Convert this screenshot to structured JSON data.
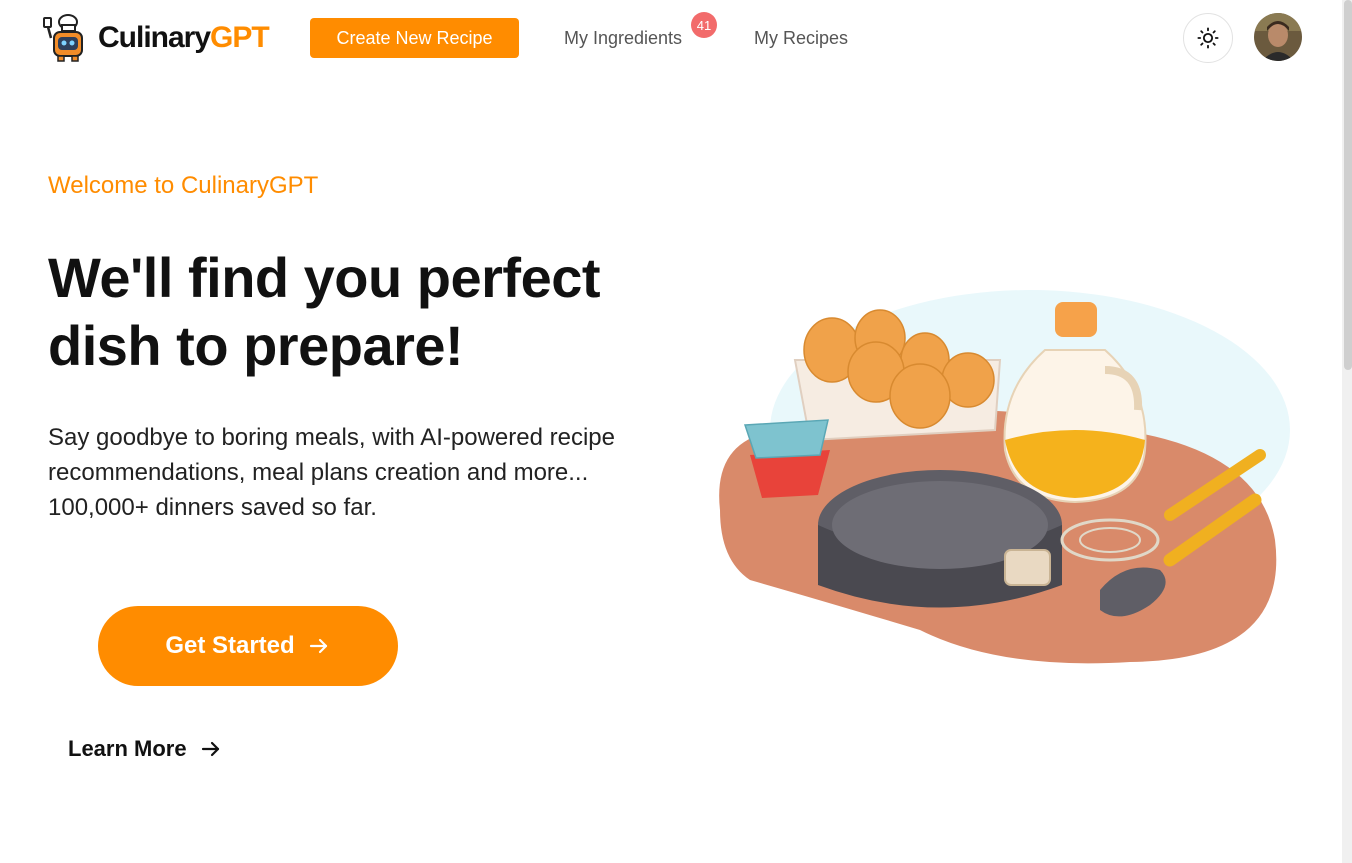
{
  "brand": {
    "name_part1": "Culinary",
    "name_part2": "GPT"
  },
  "nav": {
    "create_label": "Create New Recipe",
    "ingredients_label": "My Ingredients",
    "ingredients_count": "41",
    "recipes_label": "My Recipes"
  },
  "icons": {
    "logo": "chef-robot-icon",
    "theme": "sun-icon",
    "arrow": "arrow-right-icon"
  },
  "hero": {
    "eyebrow": "Welcome to CulinaryGPT",
    "headline": "We'll find you perfect dish to prepare!",
    "subtext": "Say goodbye to boring meals, with AI-powered recipe recommendations, meal plans creation and more... 100,000+ dinners saved so far.",
    "cta_primary": "Get Started",
    "cta_secondary": "Learn More"
  },
  "colors": {
    "accent": "#ff8c00",
    "badge": "#f26b6b",
    "text": "#111111",
    "nav_text": "#555555"
  }
}
